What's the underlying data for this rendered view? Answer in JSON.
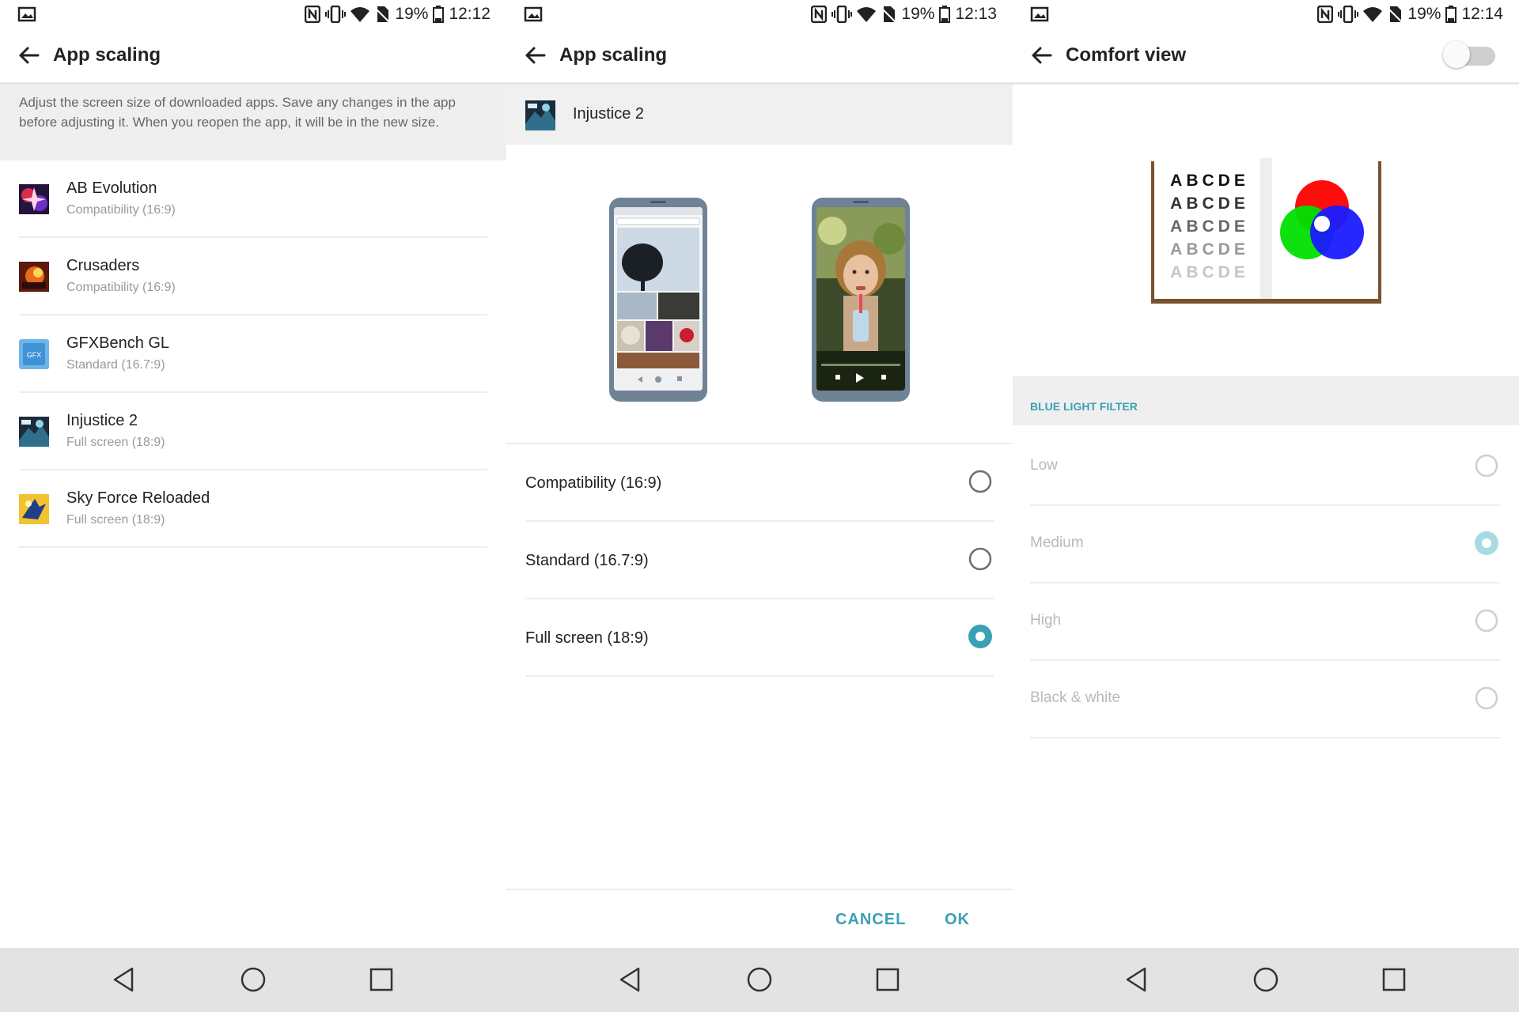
{
  "colors": {
    "accent": "#3aa0b4",
    "navbar_bg": "#e3e3e3",
    "section_bg": "#efefef",
    "disabled_text": "#b9b9b9"
  },
  "panels": [
    {
      "status": {
        "battery": "19%",
        "time": "12:12"
      },
      "appbar": {
        "title": "App scaling",
        "back_icon": "arrow-left-icon"
      },
      "description": "Adjust the screen size of downloaded apps. Save any changes in the app before adjusting it. When you reopen the app, it will be in the new size.",
      "apps": [
        {
          "name": "AB Evolution",
          "mode": "Compatibility (16:9)"
        },
        {
          "name": "Crusaders",
          "mode": "Compatibility (16:9)"
        },
        {
          "name": "GFXBench GL",
          "mode": "Standard (16.7:9)"
        },
        {
          "name": "Injustice 2",
          "mode": "Full screen (18:9)"
        },
        {
          "name": "Sky Force Reloaded",
          "mode": "Full screen (18:9)"
        }
      ]
    },
    {
      "status": {
        "battery": "19%",
        "time": "12:13"
      },
      "appbar": {
        "title": "App scaling",
        "back_icon": "arrow-left-icon"
      },
      "app": {
        "name": "Injustice 2"
      },
      "options": [
        {
          "label": "Compatibility (16:9)",
          "selected": false
        },
        {
          "label": "Standard (16.7:9)",
          "selected": false
        },
        {
          "label": "Full screen (18:9)",
          "selected": true
        }
      ],
      "actions": {
        "cancel": "CANCEL",
        "ok": "OK"
      }
    },
    {
      "status": {
        "battery": "19%",
        "time": "12:14"
      },
      "appbar": {
        "title": "Comfort view",
        "back_icon": "arrow-left-icon"
      },
      "toggle": {
        "on": false
      },
      "illustration": {
        "letters": "ABCDE"
      },
      "section_title": "BLUE LIGHT FILTER",
      "options": [
        {
          "label": "Low",
          "selected": false
        },
        {
          "label": "Medium",
          "selected": true
        },
        {
          "label": "High",
          "selected": false
        },
        {
          "label": "Black & white",
          "selected": false
        }
      ]
    }
  ],
  "navbar": {
    "icons": [
      "back-triangle-icon",
      "home-circle-icon",
      "recents-square-icon"
    ]
  }
}
